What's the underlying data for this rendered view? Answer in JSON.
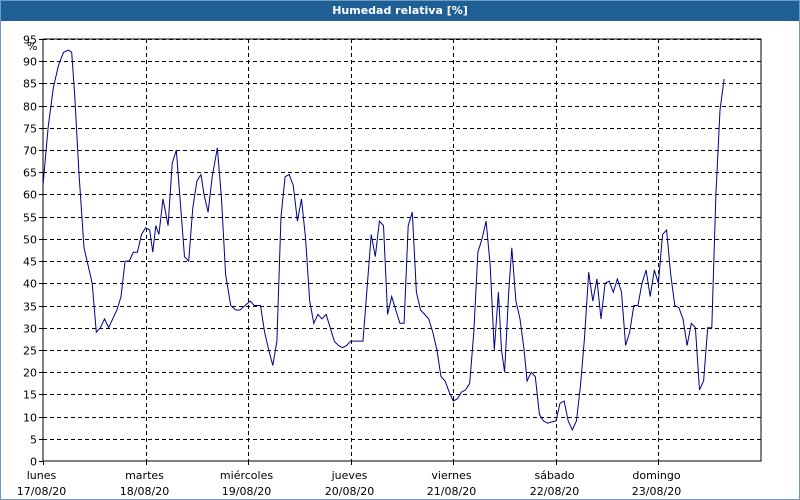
{
  "window": {
    "title": "Humedad relativa [%]"
  },
  "chart_data": {
    "type": "line",
    "title": "Humedad relativa [%]",
    "ylabel": "%",
    "xlabel": "",
    "ylim": [
      0,
      95
    ],
    "yticks": [
      0,
      5,
      10,
      15,
      20,
      25,
      30,
      35,
      40,
      45,
      50,
      55,
      60,
      65,
      70,
      75,
      80,
      85,
      90,
      95
    ],
    "grid": true,
    "line_color": "#00008b",
    "x_unit": "days since lunes 17/08/20 00:00",
    "x_range": [
      0,
      7
    ],
    "xticks": [
      {
        "day": "lunes",
        "date": "17/08/20",
        "x": 0
      },
      {
        "day": "martes",
        "date": "18/08/20",
        "x": 1
      },
      {
        "day": "miércoles",
        "date": "19/08/20",
        "x": 2
      },
      {
        "day": "jueves",
        "date": "20/08/20",
        "x": 3
      },
      {
        "day": "viernes",
        "date": "21/08/20",
        "x": 4
      },
      {
        "day": "sábado",
        "date": "22/08/20",
        "x": 5
      },
      {
        "day": "domingo",
        "date": "23/08/20",
        "x": 6
      }
    ],
    "series": [
      {
        "name": "Humedad relativa",
        "points": [
          [
            0.0,
            62
          ],
          [
            0.05,
            75
          ],
          [
            0.1,
            84
          ],
          [
            0.15,
            89
          ],
          [
            0.2,
            92
          ],
          [
            0.25,
            92.5
          ],
          [
            0.28,
            92
          ],
          [
            0.31,
            82
          ],
          [
            0.35,
            65
          ],
          [
            0.4,
            48
          ],
          [
            0.44,
            44
          ],
          [
            0.48,
            40
          ],
          [
            0.52,
            29
          ],
          [
            0.56,
            30
          ],
          [
            0.6,
            32
          ],
          [
            0.64,
            30
          ],
          [
            0.68,
            32
          ],
          [
            0.72,
            34
          ],
          [
            0.76,
            37
          ],
          [
            0.8,
            45
          ],
          [
            0.84,
            45
          ],
          [
            0.88,
            47
          ],
          [
            0.92,
            47
          ],
          [
            0.96,
            51
          ],
          [
            1.0,
            52.5
          ],
          [
            1.04,
            52
          ],
          [
            1.07,
            47
          ],
          [
            1.1,
            53
          ],
          [
            1.13,
            51
          ],
          [
            1.17,
            59
          ],
          [
            1.22,
            53
          ],
          [
            1.26,
            67
          ],
          [
            1.3,
            70
          ],
          [
            1.34,
            58
          ],
          [
            1.38,
            46
          ],
          [
            1.42,
            45
          ],
          [
            1.46,
            57
          ],
          [
            1.5,
            63
          ],
          [
            1.54,
            64.5
          ],
          [
            1.57,
            60
          ],
          [
            1.61,
            56
          ],
          [
            1.65,
            64
          ],
          [
            1.7,
            70.5
          ],
          [
            1.74,
            59
          ],
          [
            1.78,
            42
          ],
          [
            1.83,
            35
          ],
          [
            1.88,
            34
          ],
          [
            1.92,
            34
          ],
          [
            1.97,
            35
          ],
          [
            2.02,
            36
          ],
          [
            2.06,
            35
          ],
          [
            2.12,
            35
          ],
          [
            2.16,
            29
          ],
          [
            2.2,
            25
          ],
          [
            2.24,
            21.5
          ],
          [
            2.28,
            27
          ],
          [
            2.32,
            55
          ],
          [
            2.36,
            64
          ],
          [
            2.4,
            64.5
          ],
          [
            2.44,
            62
          ],
          [
            2.48,
            54
          ],
          [
            2.52,
            59
          ],
          [
            2.56,
            50
          ],
          [
            2.6,
            36
          ],
          [
            2.64,
            31
          ],
          [
            2.68,
            33
          ],
          [
            2.72,
            32
          ],
          [
            2.76,
            33
          ],
          [
            2.8,
            30
          ],
          [
            2.84,
            27
          ],
          [
            2.88,
            26
          ],
          [
            2.92,
            25.5
          ],
          [
            2.96,
            26
          ],
          [
            3.0,
            27
          ],
          [
            3.06,
            27
          ],
          [
            3.12,
            27
          ],
          [
            3.16,
            39
          ],
          [
            3.2,
            51
          ],
          [
            3.24,
            46
          ],
          [
            3.28,
            54
          ],
          [
            3.32,
            53
          ],
          [
            3.36,
            33
          ],
          [
            3.4,
            37
          ],
          [
            3.44,
            34
          ],
          [
            3.48,
            31
          ],
          [
            3.52,
            31
          ],
          [
            3.56,
            53
          ],
          [
            3.6,
            56
          ],
          [
            3.64,
            38
          ],
          [
            3.68,
            34
          ],
          [
            3.72,
            33
          ],
          [
            3.76,
            32
          ],
          [
            3.8,
            29
          ],
          [
            3.84,
            25
          ],
          [
            3.88,
            19
          ],
          [
            3.92,
            18
          ],
          [
            3.96,
            15.5
          ],
          [
            4.0,
            13.5
          ],
          [
            4.04,
            14
          ],
          [
            4.08,
            15.5
          ],
          [
            4.12,
            16
          ],
          [
            4.16,
            17.5
          ],
          [
            4.2,
            29
          ],
          [
            4.24,
            47
          ],
          [
            4.28,
            50
          ],
          [
            4.32,
            54
          ],
          [
            4.36,
            44
          ],
          [
            4.4,
            25
          ],
          [
            4.44,
            38
          ],
          [
            4.47,
            25
          ],
          [
            4.5,
            20
          ],
          [
            4.54,
            38
          ],
          [
            4.57,
            48
          ],
          [
            4.61,
            36
          ],
          [
            4.65,
            32
          ],
          [
            4.69,
            25
          ],
          [
            4.72,
            18
          ],
          [
            4.76,
            20
          ],
          [
            4.8,
            19
          ],
          [
            4.84,
            10.5
          ],
          [
            4.88,
            9
          ],
          [
            4.92,
            8.5
          ],
          [
            4.96,
            8.8
          ],
          [
            5.0,
            9
          ],
          [
            5.04,
            13
          ],
          [
            5.08,
            13.5
          ],
          [
            5.12,
            9
          ],
          [
            5.16,
            7
          ],
          [
            5.2,
            9
          ],
          [
            5.24,
            17
          ],
          [
            5.28,
            28
          ],
          [
            5.32,
            42.5
          ],
          [
            5.36,
            36
          ],
          [
            5.4,
            41
          ],
          [
            5.44,
            32
          ],
          [
            5.48,
            40
          ],
          [
            5.52,
            40.5
          ],
          [
            5.56,
            38
          ],
          [
            5.6,
            41
          ],
          [
            5.64,
            38
          ],
          [
            5.68,
            26
          ],
          [
            5.72,
            29
          ],
          [
            5.76,
            35
          ],
          [
            5.8,
            35
          ],
          [
            5.84,
            40
          ],
          [
            5.88,
            43
          ],
          [
            5.92,
            37
          ],
          [
            5.96,
            43
          ],
          [
            6.0,
            40
          ],
          [
            6.04,
            51
          ],
          [
            6.08,
            52
          ],
          [
            6.12,
            42
          ],
          [
            6.16,
            35
          ],
          [
            6.2,
            34.5
          ],
          [
            6.24,
            32
          ],
          [
            6.28,
            26
          ],
          [
            6.32,
            31
          ],
          [
            6.36,
            30
          ],
          [
            6.4,
            16
          ],
          [
            6.44,
            18
          ],
          [
            6.48,
            30
          ],
          [
            6.52,
            30
          ],
          [
            6.56,
            60
          ],
          [
            6.6,
            79
          ],
          [
            6.64,
            86
          ]
        ]
      }
    ]
  }
}
